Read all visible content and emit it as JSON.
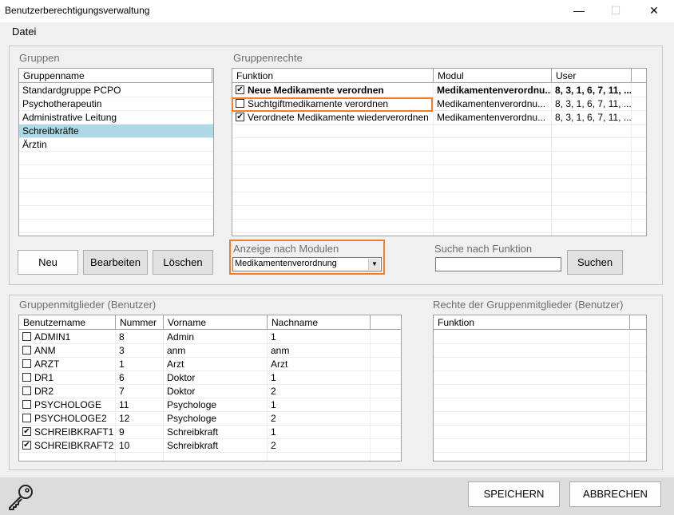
{
  "window": {
    "title": "Benutzerberechtigungsverwaltung",
    "min": "—",
    "max": "☐",
    "close": "✕"
  },
  "menu": {
    "file": "Datei"
  },
  "groups": {
    "label": "Gruppen",
    "header": "Gruppenname",
    "items": [
      "Standardgruppe PCPO",
      "Psychotherapeutin",
      "Administrative Leitung",
      "Schreibkräfte",
      "Ärztin"
    ],
    "selected": "Schreibkräfte"
  },
  "group_buttons": {
    "new": "Neu",
    "edit": "Bearbeiten",
    "delete": "Löschen"
  },
  "rights": {
    "label": "Gruppenrechte",
    "headers": [
      "Funktion",
      "Modul",
      "User"
    ],
    "rows": [
      {
        "checked": true,
        "function": "Neue Medikamente verordnen",
        "module": "Medikamentenverordnu...",
        "user": "8, 3, 1, 6, 7, 11, ...",
        "bold": true
      },
      {
        "checked": false,
        "function": "Suchtgiftmedikamente verordnen",
        "module": "Medikamentenverordnu...",
        "user": "8, 3, 1, 6, 7, 11, ...",
        "bold": false
      },
      {
        "checked": true,
        "function": "Verordnete Medikamente wiederverordnen",
        "module": "Medikamentenverordnu...",
        "user": "8, 3, 1, 6, 7, 11, ...",
        "bold": false
      }
    ]
  },
  "module_filter": {
    "label": "Anzeige nach Modulen",
    "value": "Medikamentenverordnung"
  },
  "function_search": {
    "label": "Suche nach Funktion",
    "value": "",
    "button": "Suchen"
  },
  "members": {
    "label": "Gruppenmitglieder (Benutzer)",
    "headers": [
      "Benutzername",
      "Nummer",
      "Vorname",
      "Nachname"
    ],
    "rows": [
      {
        "checked": false,
        "user": "ADMIN1",
        "number": "8",
        "first": "Admin",
        "last": "1"
      },
      {
        "checked": false,
        "user": "ANM",
        "number": "3",
        "first": "anm",
        "last": "anm"
      },
      {
        "checked": false,
        "user": "ARZT",
        "number": "1",
        "first": "Arzt",
        "last": "Arzt"
      },
      {
        "checked": false,
        "user": "DR1",
        "number": "6",
        "first": "Doktor",
        "last": "1"
      },
      {
        "checked": false,
        "user": "DR2",
        "number": "7",
        "first": "Doktor",
        "last": "2"
      },
      {
        "checked": false,
        "user": "PSYCHOLOGE",
        "number": "11",
        "first": "Psychologe",
        "last": "1"
      },
      {
        "checked": false,
        "user": "PSYCHOLOGE2",
        "number": "12",
        "first": "Psychologe",
        "last": "2"
      },
      {
        "checked": true,
        "user": "SCHREIBKRAFT1",
        "number": "9",
        "first": "Schreibkraft",
        "last": "1"
      },
      {
        "checked": true,
        "user": "SCHREIBKRAFT2",
        "number": "10",
        "first": "Schreibkraft",
        "last": "2"
      }
    ]
  },
  "member_rights": {
    "label": "Rechte der Gruppenmitglieder (Benutzer)",
    "header": "Funktion"
  },
  "footer": {
    "save": "SPEICHERN",
    "cancel": "ABBRECHEN",
    "icon": "key-icon"
  }
}
